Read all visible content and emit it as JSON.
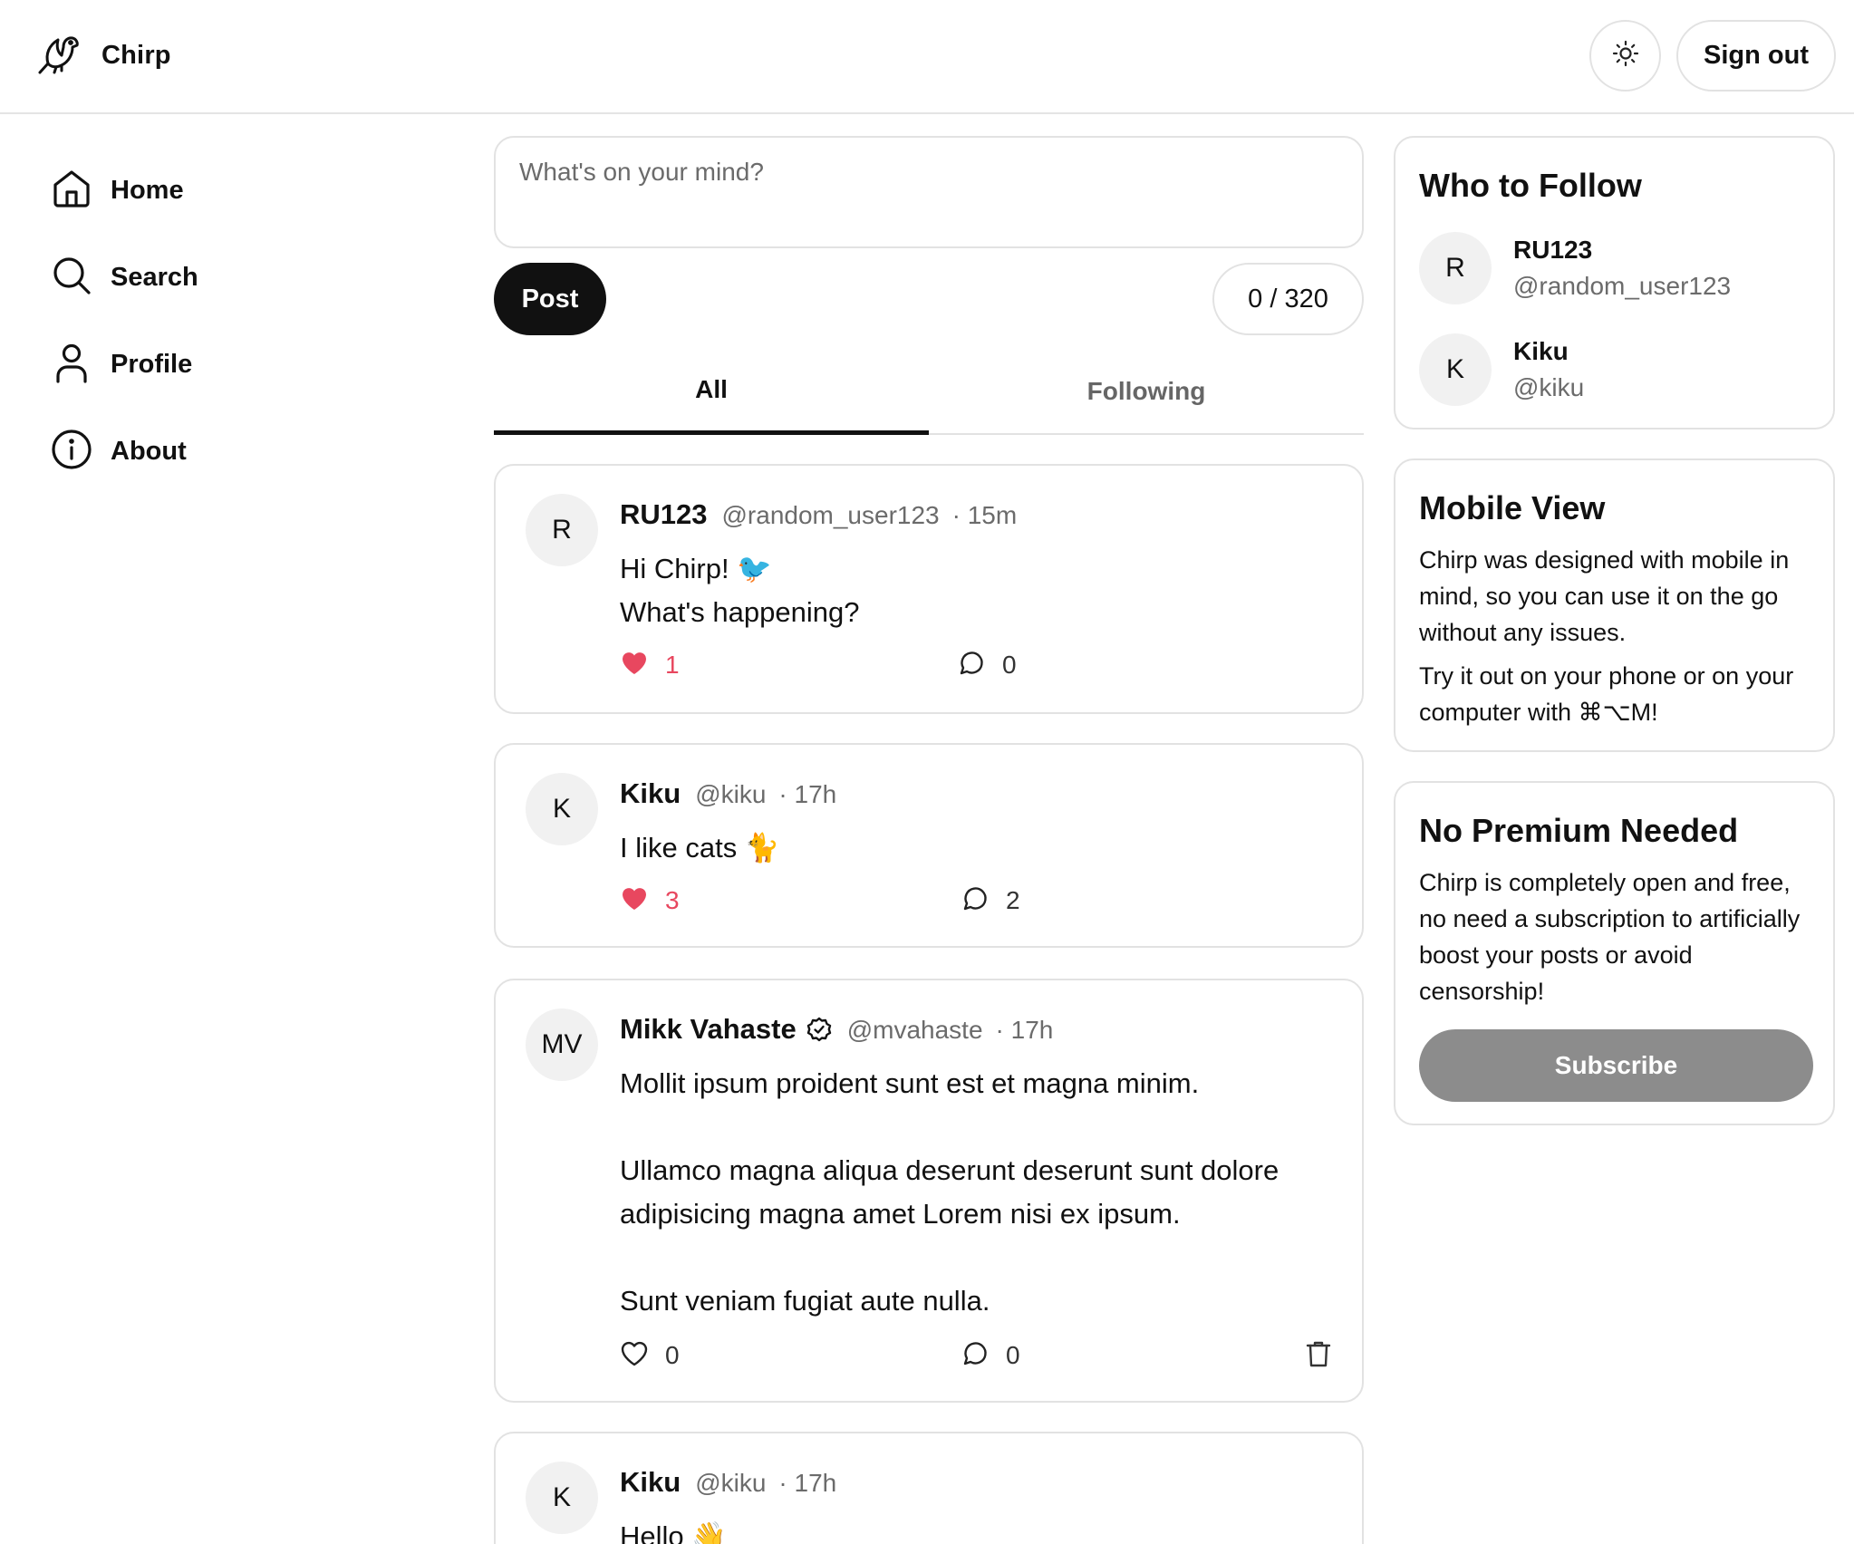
{
  "header": {
    "brand_name": "Chirp",
    "sign_out_label": "Sign out",
    "theme_icon": "sun-icon",
    "logo_icon": "bird-logo-icon"
  },
  "sidebar": {
    "items": [
      {
        "label": "Home",
        "icon": "home-icon",
        "active": true
      },
      {
        "label": "Search",
        "icon": "search-icon"
      },
      {
        "label": "Profile",
        "icon": "user-icon"
      },
      {
        "label": "About",
        "icon": "info-icon"
      }
    ]
  },
  "composer": {
    "placeholder": "What's on your mind?",
    "post_label": "Post",
    "counter": "0 / 320"
  },
  "tabs": {
    "all": "All",
    "following": "Following",
    "active": "All"
  },
  "posts": [
    {
      "avatar": "R",
      "name": "RU123",
      "handle": "@random_user123",
      "time": "· 15m",
      "body": "Hi Chirp! 🐦\nWhat's happening?",
      "likes": "1",
      "liked": true,
      "comments": "0"
    },
    {
      "avatar": "K",
      "name": "Kiku",
      "handle": "@kiku",
      "time": "· 17h",
      "body": "I like cats 🐈",
      "likes": "3",
      "liked": true,
      "comments": "2"
    },
    {
      "avatar": "MV",
      "name": "Mikk Vahaste",
      "verified": true,
      "handle": "@mvahaste",
      "time": "· 17h",
      "body": "Mollit ipsum proident sunt est et magna minim.\n\nUllamco magna aliqua deserunt deserunt sunt dolore adipisicing magna amet Lorem nisi ex ipsum.\n\nSunt veniam fugiat aute nulla.",
      "likes": "0",
      "liked": false,
      "comments": "0",
      "deletable": true
    },
    {
      "avatar": "K",
      "name": "Kiku",
      "handle": "@kiku",
      "time": "· 17h",
      "body": "Hello 👋"
    }
  ],
  "who_to_follow": {
    "title": "Who to Follow",
    "users": [
      {
        "avatar": "R",
        "name": "RU123",
        "handle": "@random_user123"
      },
      {
        "avatar": "K",
        "name": "Kiku",
        "handle": "@kiku"
      }
    ]
  },
  "mobile_view": {
    "title": "Mobile View",
    "para1": "Chirp was designed with mobile in mind, so you can use it on the go without any issues.",
    "para2": "Try it out on your phone or on your computer with ⌘⌥M!"
  },
  "premium": {
    "title": "No Premium Needed",
    "para": "Chirp is completely open and free, no need a subscription to artificially boost your posts or avoid censorship!",
    "subscribe_label": "Subscribe"
  },
  "colors": {
    "accent": "#111111",
    "like": "#e8475f",
    "subscribe_disabled": "#8c8c8c",
    "border": "#e2e2e2"
  }
}
